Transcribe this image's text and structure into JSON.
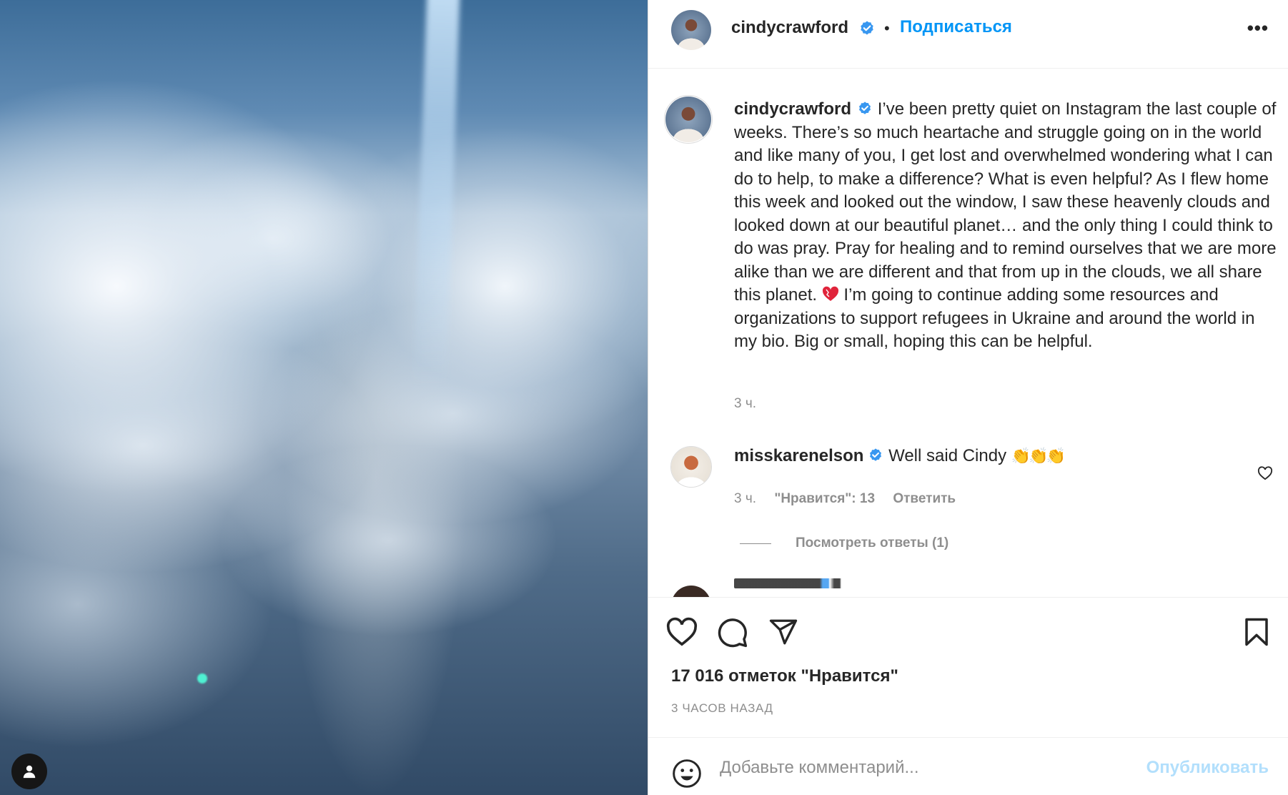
{
  "post": {
    "author": "cindycrawford",
    "follow_label": "Подписаться",
    "header_dot": "•",
    "more_label": "•••",
    "caption_part1": "I’ve been pretty quiet on Instagram the last couple of weeks. There’s so much heartache and struggle going on in the world and like many of you, I get lost and overwhelmed wondering what I can do to help, to make a difference? What is even helpful? As I flew home this week and looked out the window, I saw these heavenly clouds and looked down at our beautiful planet… and the only thing I could think to do was pray. Pray for healing and to remind ourselves that we are more alike than we are different and that from up in the clouds, we all share this planet.",
    "caption_part2": "I’m going to continue adding some resources and organizations to support refugees in Ukraine and around the world in my bio. Big or small, hoping this can be helpful.",
    "caption_time": "3 ч.",
    "likes": "17 016 отметок \"Нравится\"",
    "posted": "3 ЧАСОВ НАЗАД"
  },
  "comments": [
    {
      "author": "misskarenelson",
      "text": "Well said Cindy",
      "emoji": "👏👏👏",
      "time": "3 ч.",
      "likes": "\"Нравится\": 13",
      "reply_label": "Ответить",
      "view_replies": "Посмотреть ответы (1)"
    }
  ],
  "add_comment": {
    "placeholder": "Добавьте комментарий...",
    "publish_label": "Опубликовать"
  },
  "icons": {
    "verified": "verified-badge-icon",
    "like": "heart-icon",
    "comment": "comment-bubble-icon",
    "share": "paper-plane-icon",
    "save": "bookmark-icon",
    "emoji": "smiley-icon",
    "user_tag": "user-tag-icon",
    "heart_emoji": "heart-emoji"
  },
  "colors": {
    "accent": "#0095f6",
    "verified": "#3897f0",
    "muted": "#8e8e8e",
    "publish_disabled": "#b2dffc"
  }
}
